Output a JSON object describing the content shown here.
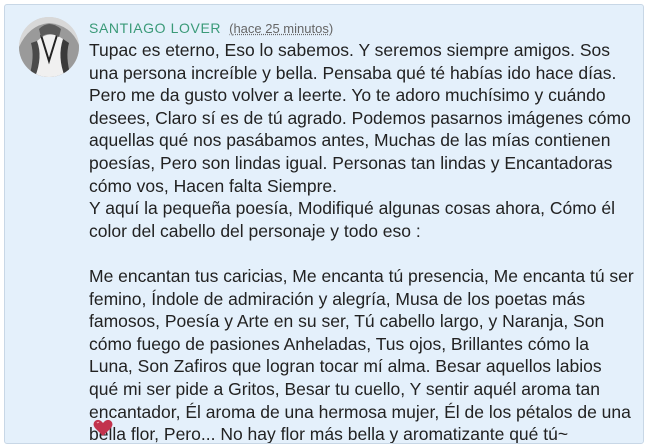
{
  "comment": {
    "author": "SANTIAGO LOVER",
    "timestamp": "(hace 25 minutos)",
    "paragraph_1": "Tupac es eterno, Eso lo sabemos. Y seremos siempre amigos. Sos una persona increíble y bella. Pensaba qué té habías ido hace días. Pero me da gusto volver a leerte. Yo te adoro muchísimo y cuándo desees, Claro sí es de tú agrado. Podemos pasarnos imágenes cómo aquellas qué nos pasábamos antes, Muchas de las mías contienen poesías, Pero son lindas igual. Personas tan lindas y Encantadoras cómo vos, Hacen falta Siempre.",
    "paragraph_2": "Y aquí la pequeña poesía, Modifiqué algunas cosas ahora, Cómo él color del cabello del personaje y todo eso :",
    "poem": "Me encantan tus caricias, Me encanta tú presencia, Me encanta tú ser femino, Índole de admiración y alegría, Musa de los poetas más famosos, Poesía y Arte en su ser, Tú cabello largo, y Naranja, Son cómo fuego de pasiones Anheladas, Tus ojos, Brillantes cómo la Luna, Son Zafiros que logran tocar mí alma. Besar aquellos labios qué mi ser pide a Gritos, Besar tu cuello, Y sentir aquél aroma tan encantador, Él aroma de una hermosa mujer, Él de los pétalos de una bella flor, Pero... No hay flor más bella y aromatizante qué tú~",
    "emoji": "heart-emoji"
  },
  "colors": {
    "card_background": "#e4f0fb",
    "username": "#3a9a78",
    "text": "#222222",
    "heart": "#c2334d"
  }
}
